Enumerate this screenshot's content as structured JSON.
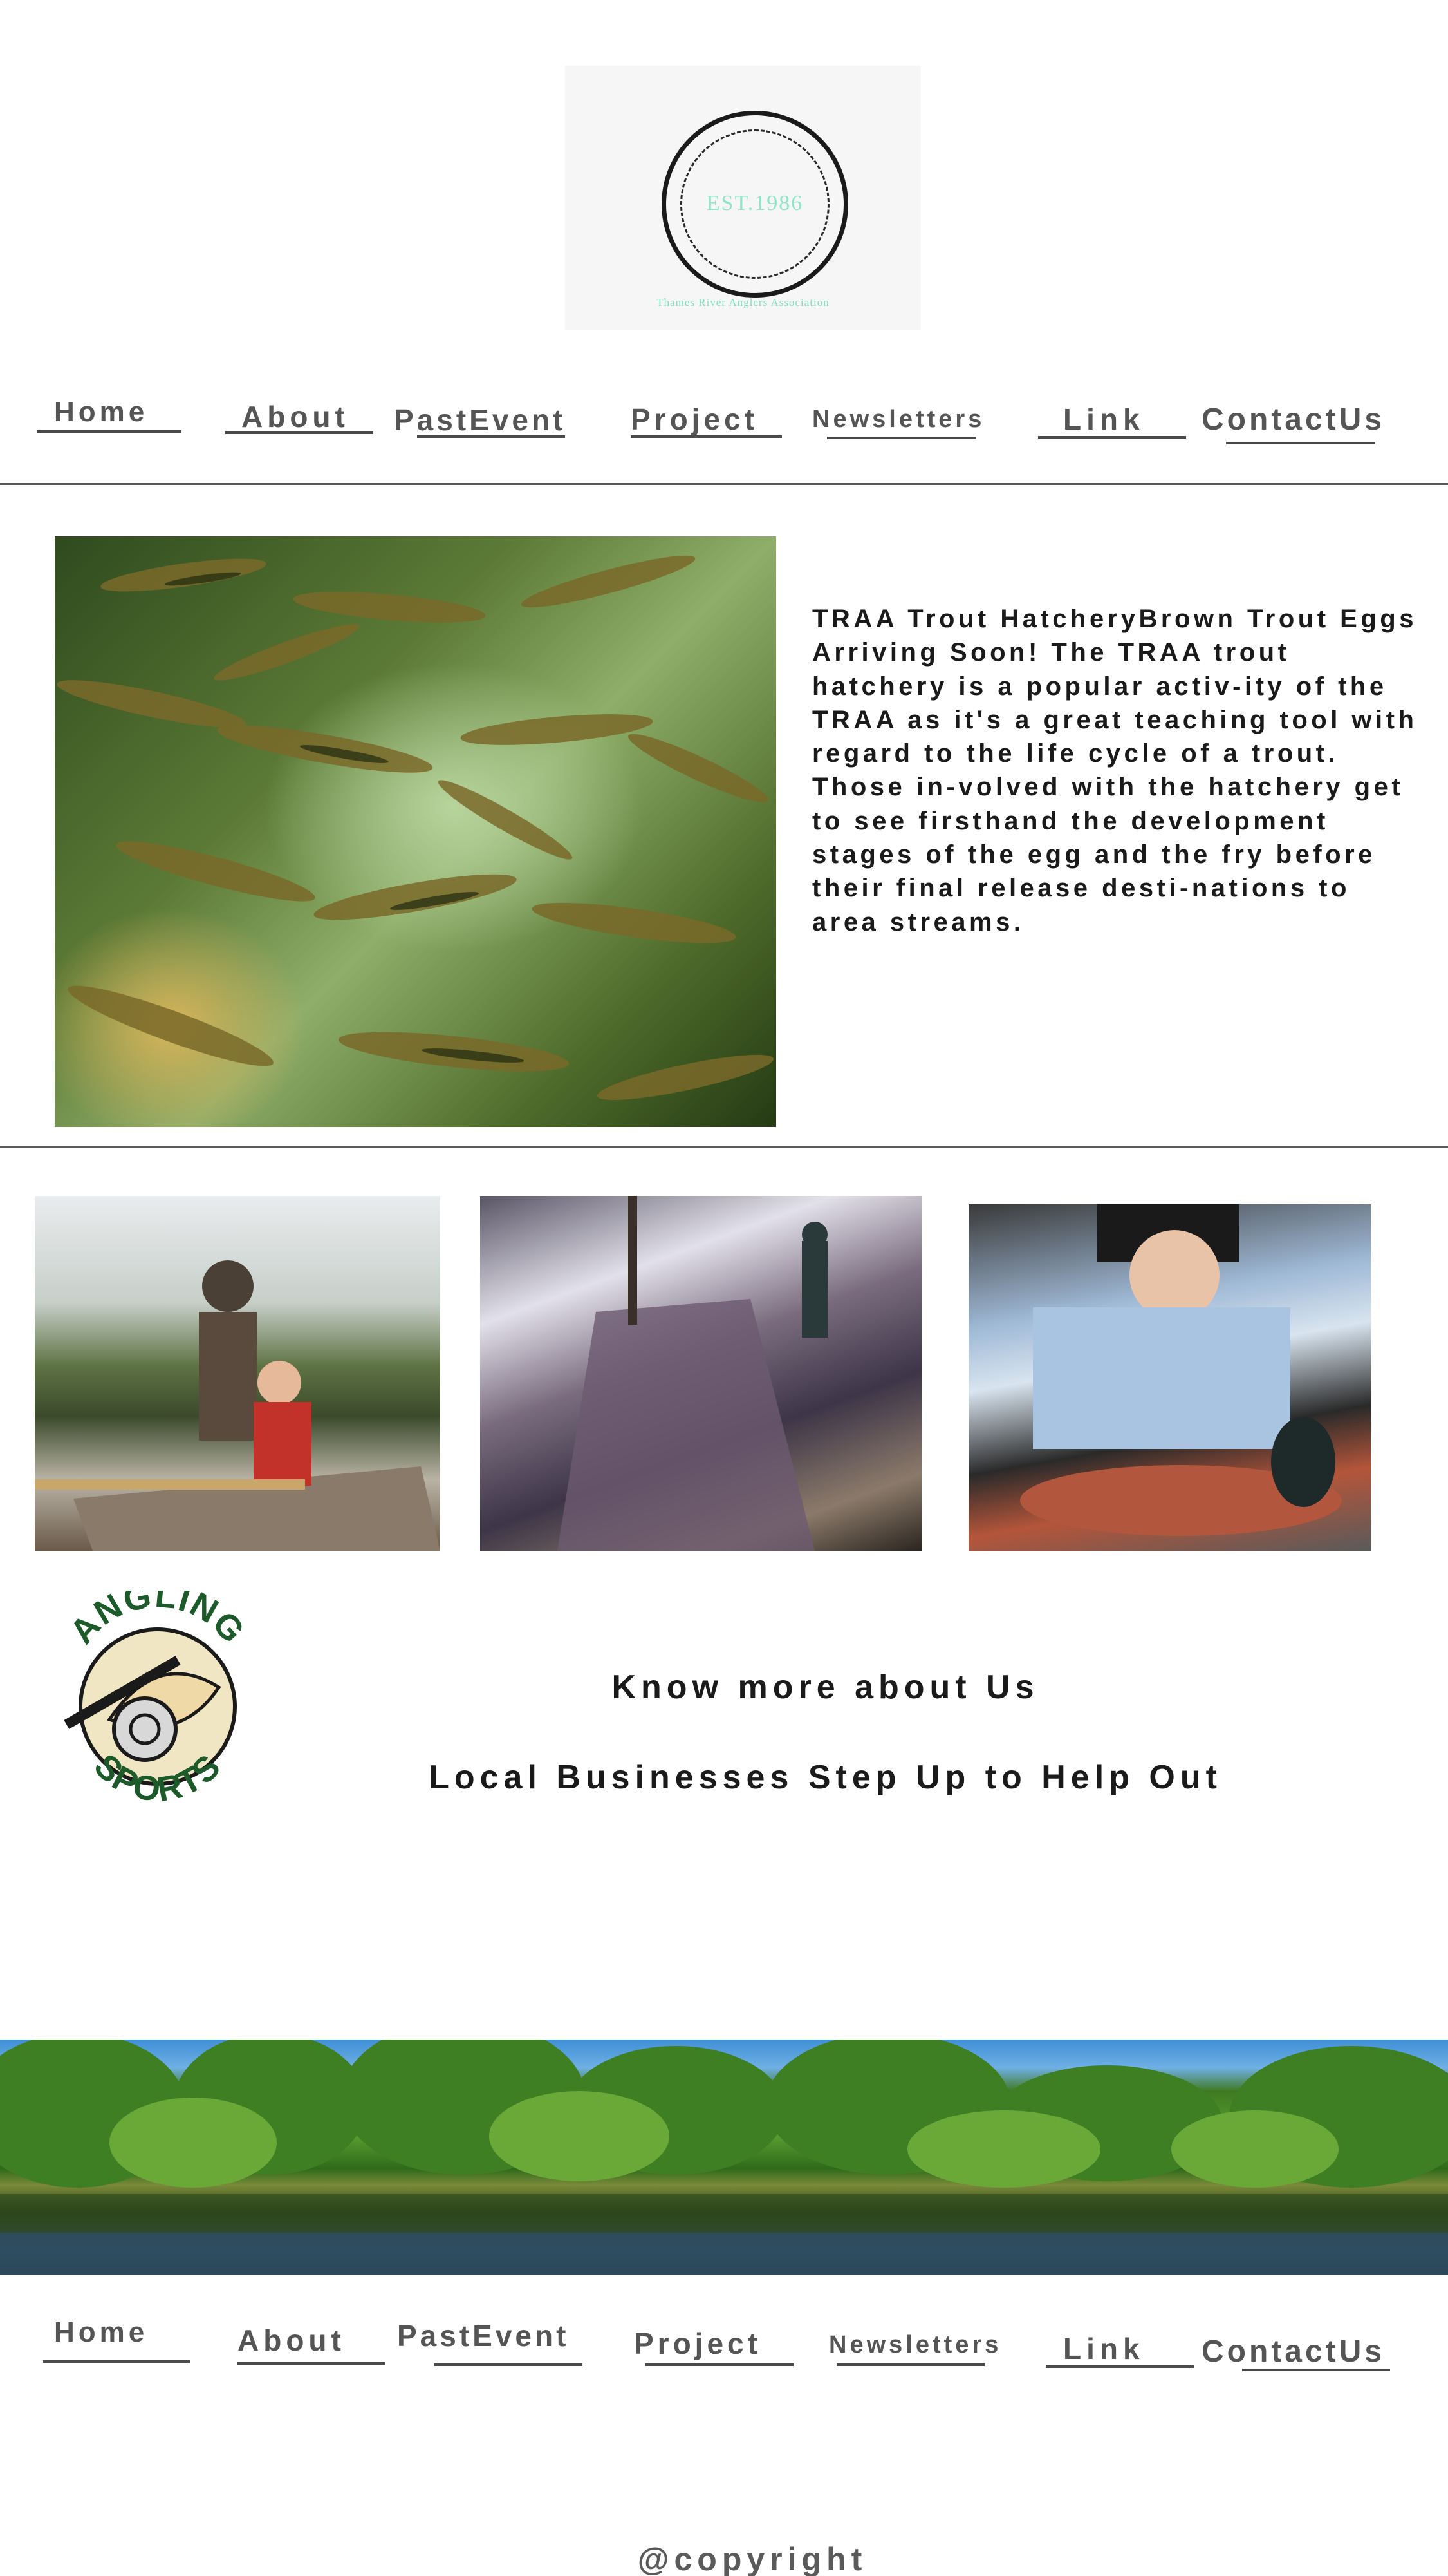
{
  "logo": {
    "established": "EST.1986",
    "tagline": "Thames River Anglers Association"
  },
  "nav": {
    "home": "Home",
    "about": "About",
    "past_event": "PastEvent",
    "project": "Project",
    "newsletters": "Newsletters",
    "link": "Link",
    "contact": "ContactUs"
  },
  "hero": {
    "paragraph": "TRAA Trout HatcheryBrown Trout Eggs Arriving Soon! The TRAA trout hatchery is a popular activ-ity of the TRAA as it's a great teaching tool with regard to the life cycle of a trout. Those in-volved with the hatchery get to see firsthand the development stages of the egg and the fry before their final release desti-nations to area streams."
  },
  "sponsor": {
    "top_text": "ANGLING",
    "bottom_text": "SPORTS"
  },
  "links": {
    "know_more": "Know more about Us",
    "local_businesses": "Local Businesses Step Up to Help Out"
  },
  "footer": {
    "copyright": "@copyright"
  },
  "images": {
    "hero": "trout-fry-underwater-photo",
    "boat": "father-child-canoe-photo",
    "stream": "winter-stream-angler-photo",
    "kid": "child-holding-trout-photo",
    "banner": "river-panorama-photo"
  },
  "colors": {
    "nav_text": "#555555",
    "body_text": "#1a1a1a",
    "logo_accent": "#8fe6c6",
    "badge_green": "#1c5a2a",
    "badge_cream": "#f1e6c4"
  }
}
